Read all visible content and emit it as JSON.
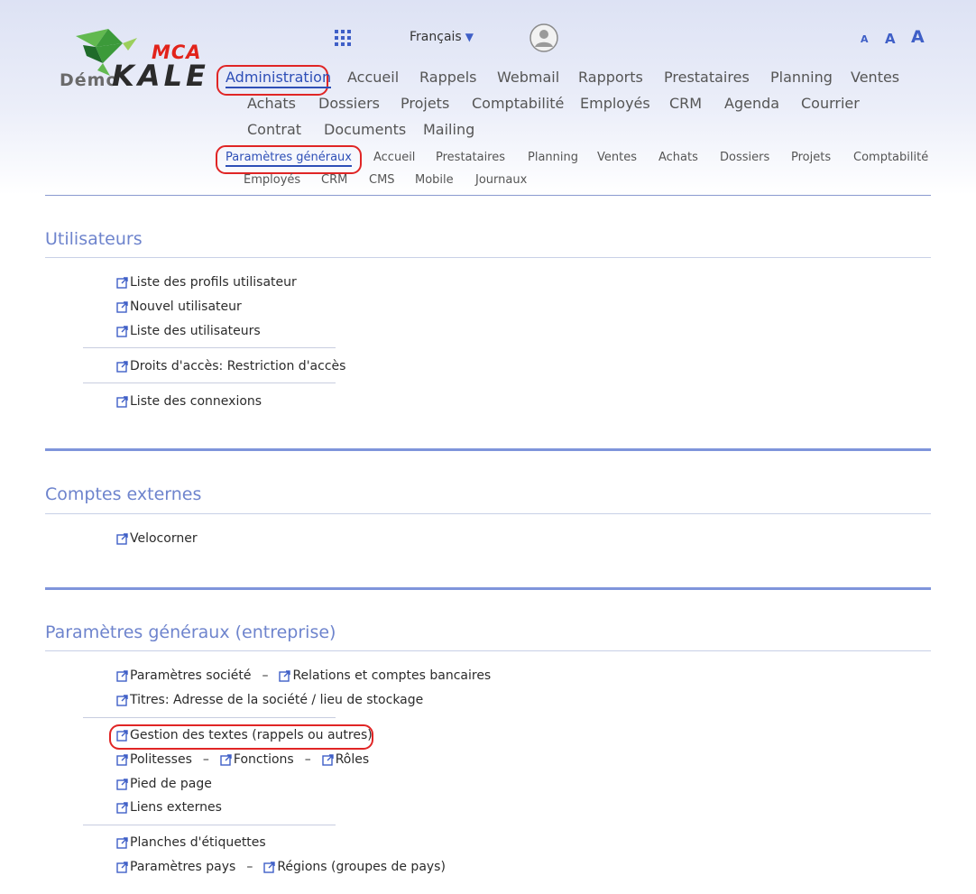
{
  "logo": {
    "demo": "Démo",
    "mca": "MCA",
    "kale": "KALE",
    "bird_colors": [
      "#3c9a3a",
      "#62b950",
      "#1f6b2a",
      "#9bcf5c"
    ]
  },
  "header": {
    "apps_icon": "grid-icon",
    "language": "Français",
    "language_icon": "chevron-down-icon",
    "avatar_icon": "user-avatar-icon",
    "font_sizes": [
      "A",
      "A",
      "A"
    ]
  },
  "nav_main": [
    "Administration",
    "Accueil",
    "Rappels",
    "Webmail",
    "Rapports",
    "Prestataires",
    "Planning",
    "Ventes",
    "Achats",
    "Dossiers",
    "Projets",
    "Comptabilité",
    "Employés",
    "CRM",
    "Agenda",
    "Courrier",
    "Contrat",
    "Documents",
    "Mailing"
  ],
  "nav_sub": [
    "Paramètres généraux",
    "Accueil",
    "Prestataires",
    "Planning",
    "Ventes",
    "Achats",
    "Dossiers",
    "Projets",
    "Comptabilité",
    "Employés",
    "CRM",
    "CMS",
    "Mobile",
    "Journaux"
  ],
  "sections": {
    "utilisateurs": {
      "title": "Utilisateurs",
      "items": [
        "Liste des profils utilisateur",
        "Nouvel utilisateur",
        "Liste des utilisateurs",
        "Droits d'accès: Restriction d'accès",
        "Liste des connexions"
      ]
    },
    "comptes": {
      "title": "Comptes externes",
      "items": [
        "Velocorner"
      ]
    },
    "params": {
      "title": "Paramètres généraux (entreprise)",
      "items": [
        "Paramètres société",
        "Relations et comptes bancaires",
        "Titres: Adresse de la société / lieu de stockage",
        "Gestion des textes (rappels ou autres)",
        "Politesses",
        "Fonctions",
        "Rôles",
        "Pied de page",
        "Liens externes",
        "Planches d'étiquettes",
        "Paramètres pays",
        "Régions (groupes de pays)"
      ],
      "separator": "–"
    }
  },
  "colors": {
    "accent": "#2e4fb7",
    "highlight": "#e02525",
    "section_title": "#6e84cd"
  }
}
